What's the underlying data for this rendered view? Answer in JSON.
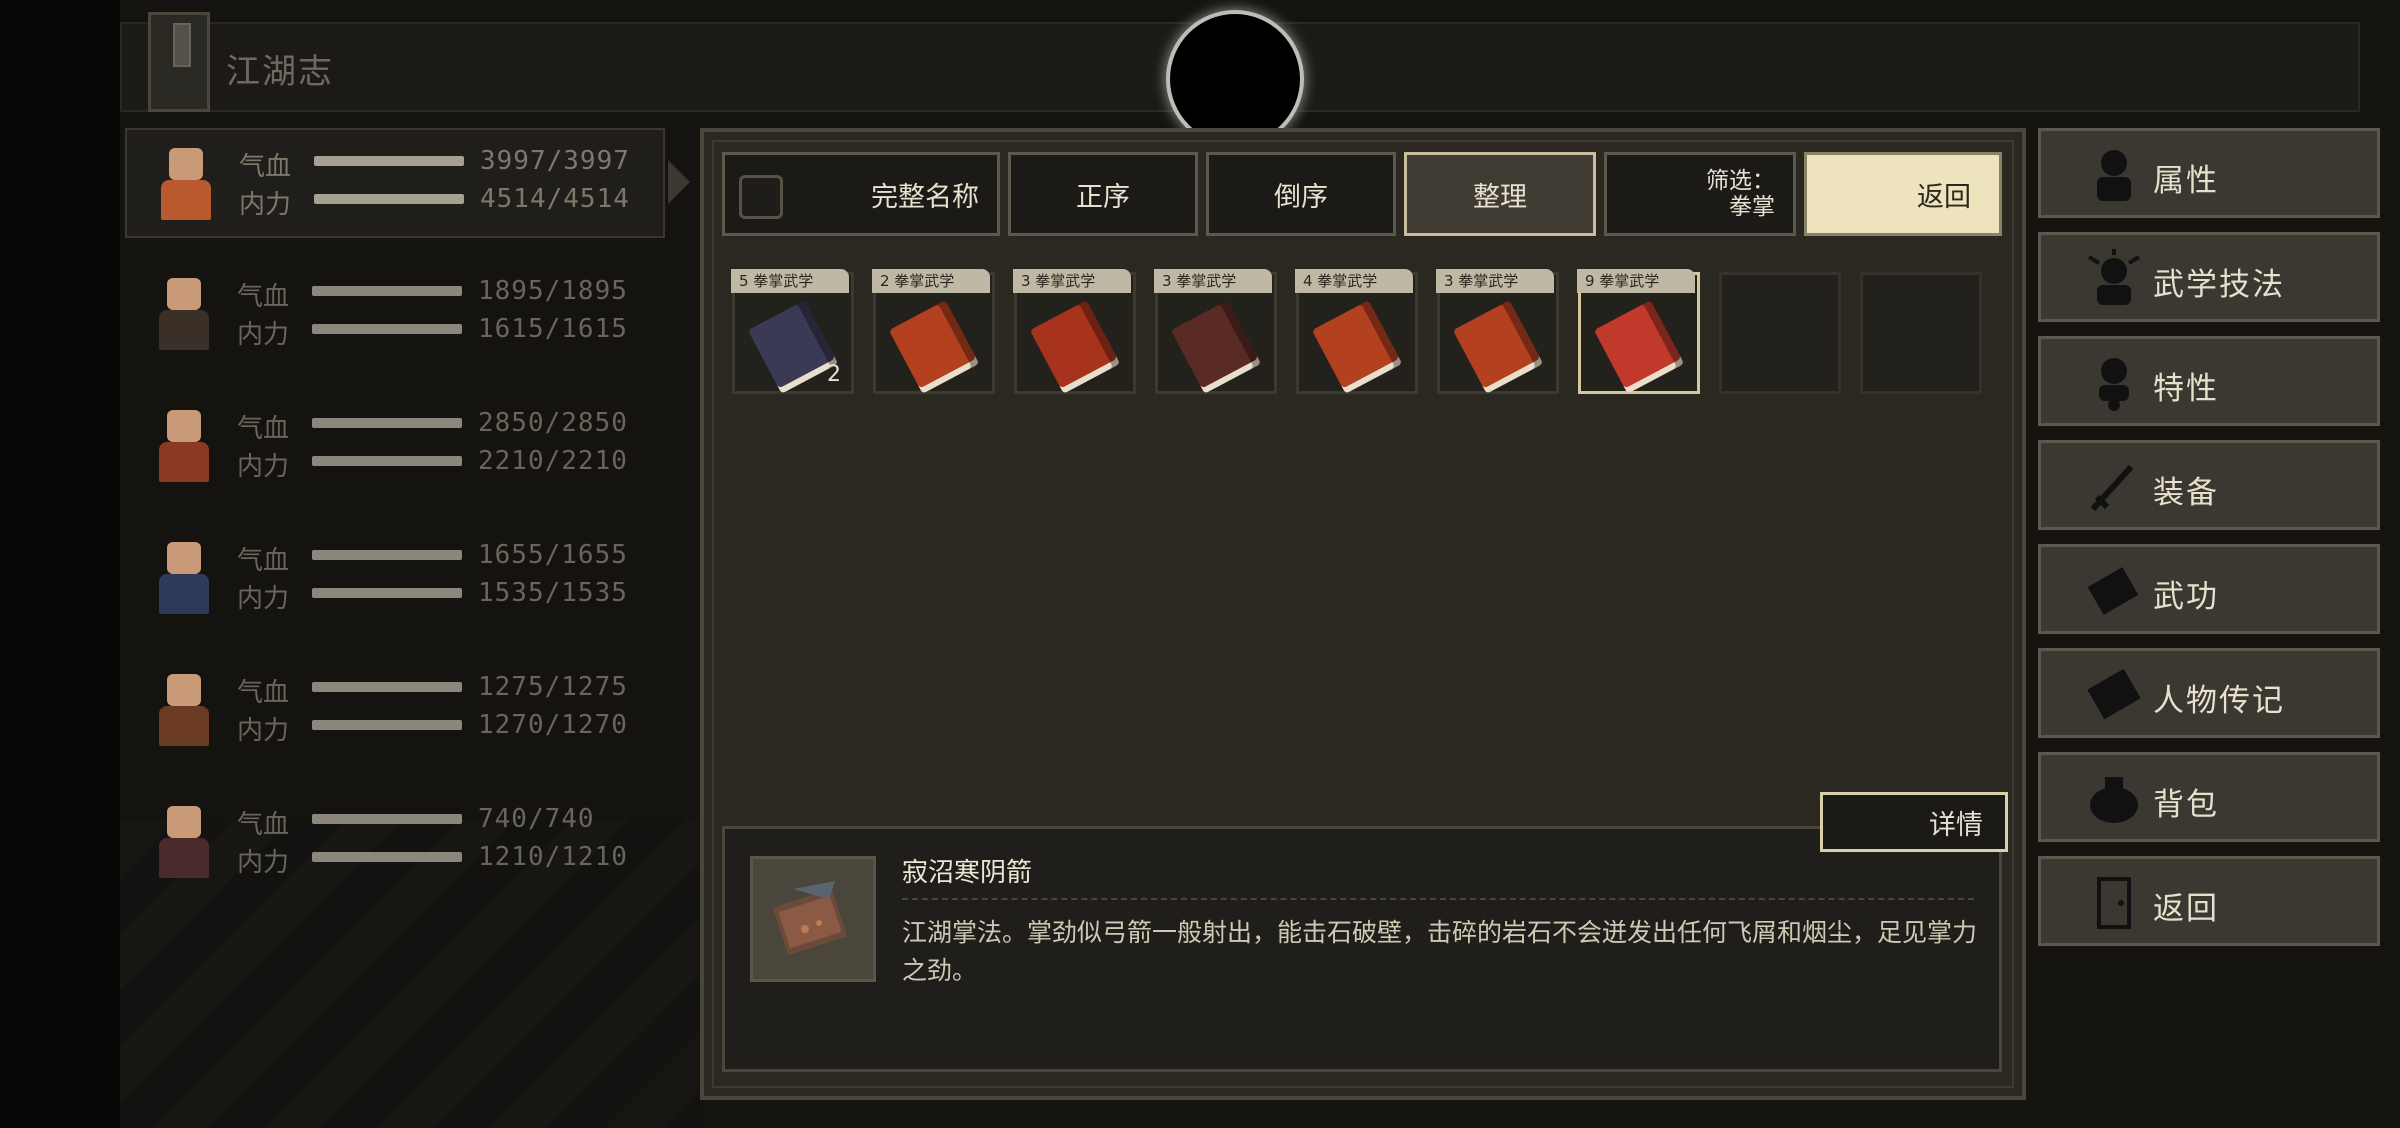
{
  "header": {
    "title": "江湖志"
  },
  "characters": [
    {
      "hp_label": "气血",
      "mp_label": "内力",
      "hp": "3997/3997",
      "mp": "4514/4514",
      "selected": true,
      "color": "#b85a2e"
    },
    {
      "hp_label": "气血",
      "mp_label": "内力",
      "hp": "1895/1895",
      "mp": "1615/1615",
      "selected": false,
      "color": "#3a3028"
    },
    {
      "hp_label": "气血",
      "mp_label": "内力",
      "hp": "2850/2850",
      "mp": "2210/2210",
      "selected": false,
      "color": "#8a3a22"
    },
    {
      "hp_label": "气血",
      "mp_label": "内力",
      "hp": "1655/1655",
      "mp": "1535/1535",
      "selected": false,
      "color": "#2f3a5a"
    },
    {
      "hp_label": "气血",
      "mp_label": "内力",
      "hp": "1275/1275",
      "mp": "1270/1270",
      "selected": false,
      "color": "#6a3a22"
    },
    {
      "hp_label": "气血",
      "mp_label": "内力",
      "hp": "740/740",
      "mp": "1210/1210",
      "selected": false,
      "color": "#4a2a2a"
    }
  ],
  "toolbar": {
    "full_name": "完整名称",
    "asc": "正序",
    "desc": "倒序",
    "organize": "整理",
    "filter_label": "筛选：",
    "filter_value": "拳掌",
    "back": "返回"
  },
  "items": [
    {
      "tag": "5 拳掌武学",
      "count": "2",
      "icon": "scroll-dark-icon",
      "color": "#3b3a55"
    },
    {
      "tag": "2 拳掌武学",
      "count": "",
      "icon": "red-book-icon",
      "color": "#b3401f"
    },
    {
      "tag": "3 拳掌武学",
      "count": "",
      "icon": "red-book-icon",
      "color": "#a8331c"
    },
    {
      "tag": "3 拳掌武学",
      "count": "",
      "icon": "dark-book-icon",
      "color": "#5a2a24"
    },
    {
      "tag": "4 拳掌武学",
      "count": "",
      "icon": "red-scroll-icon",
      "color": "#b3401f"
    },
    {
      "tag": "3 拳掌武学",
      "count": "",
      "icon": "red-book-icon",
      "color": "#b3401f"
    },
    {
      "tag": "9 拳掌武学",
      "count": "",
      "icon": "broken-scroll-icon",
      "color": "#c0392b"
    }
  ],
  "detail": {
    "button": "详情",
    "name": "寂沼寒阴箭",
    "text": "江湖掌法。掌劲似弓箭一般射出，能击石破壁，击碎的岩石不会迸发出任何飞屑和烟尘，足见掌力之劲。"
  },
  "menu": [
    {
      "label": "属性",
      "icon": "person-icon"
    },
    {
      "label": "武学技法",
      "icon": "martial-person-icon"
    },
    {
      "label": "特性",
      "icon": "trait-person-icon"
    },
    {
      "label": "装备",
      "icon": "sword-icon"
    },
    {
      "label": "武功",
      "icon": "book-icon"
    },
    {
      "label": "人物传记",
      "icon": "scroll-icon"
    },
    {
      "label": "背包",
      "icon": "bag-icon"
    },
    {
      "label": "返回",
      "icon": "door-icon"
    }
  ]
}
